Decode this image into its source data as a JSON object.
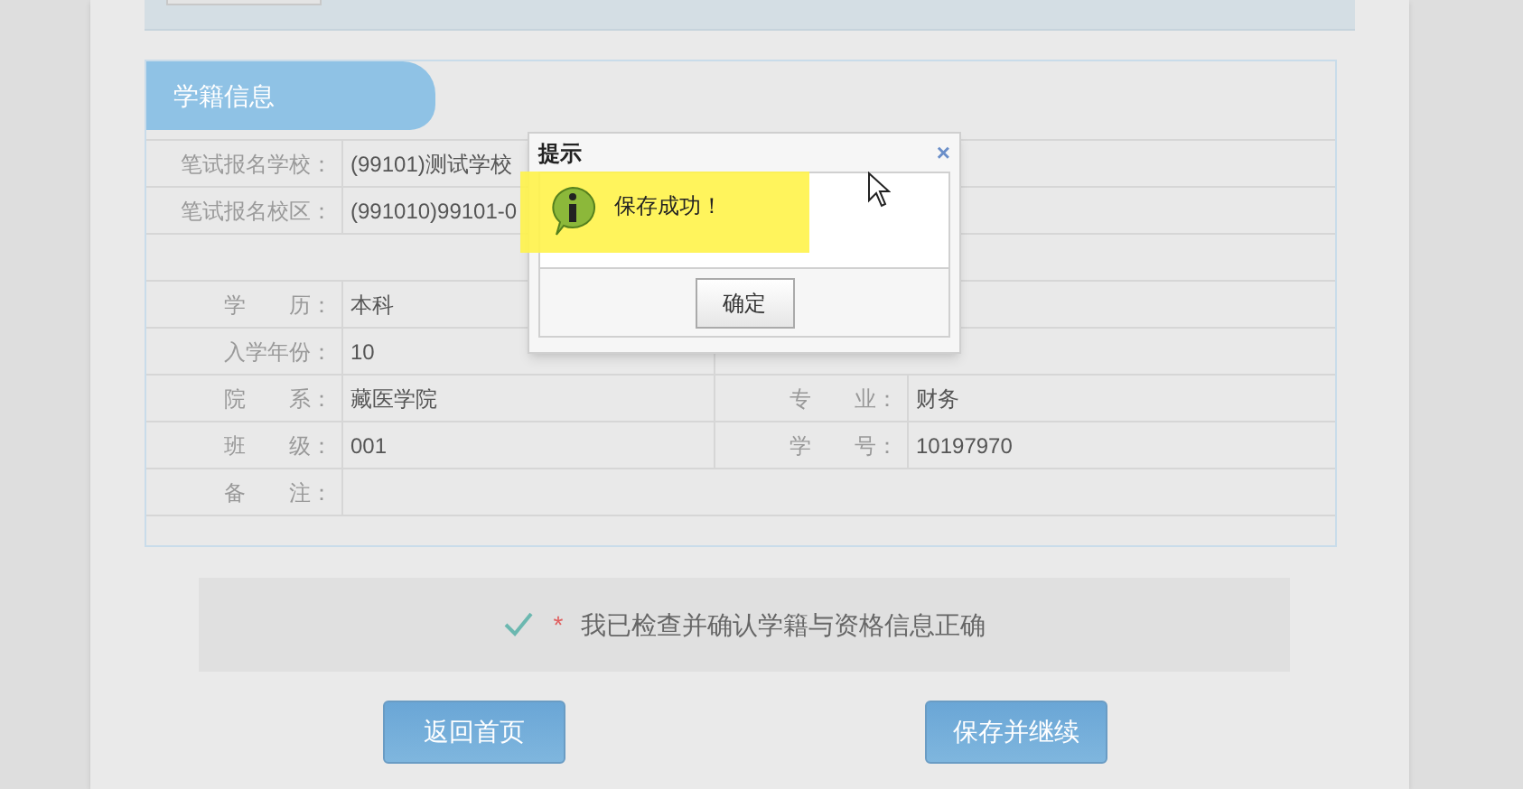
{
  "section": {
    "title": "学籍信息"
  },
  "rows": [
    {
      "kind": "wide",
      "label": "笔试报名学校：",
      "value": "(99101)测试学校"
    },
    {
      "kind": "wide",
      "label": "笔试报名校区：",
      "value": "(991010)99101-0"
    },
    {
      "kind": "blank"
    },
    {
      "kind": "pair",
      "label": "学　　历：",
      "value": "本科"
    },
    {
      "kind": "pair",
      "label": "入学年份：",
      "value": "10"
    },
    {
      "kind": "pair",
      "label": "院　　系：",
      "value": "藏医学院",
      "label2": "专　　业：",
      "value2": "财务"
    },
    {
      "kind": "pair",
      "label": "班　　级：",
      "value": "001",
      "label2": "学　　号：",
      "value2": "10197970"
    },
    {
      "kind": "wide",
      "label": "备　　注：",
      "value": ""
    },
    {
      "kind": "blank"
    }
  ],
  "confirm": {
    "checked": true,
    "required": "*",
    "text": "我已检查并确认学籍与资格信息正确"
  },
  "buttons": [
    "返回首页",
    "保存并继续"
  ],
  "dialog": {
    "title": "提示",
    "close": "×",
    "message": "保存成功！",
    "ok": "确定"
  }
}
